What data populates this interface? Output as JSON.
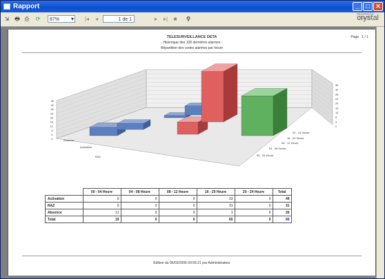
{
  "window": {
    "title": "Rapport"
  },
  "toolbar": {
    "zoom": "87%",
    "page": "1 de 1",
    "brand": "crystal",
    "brand_small": "Business Objects"
  },
  "report": {
    "title": "TELESURVEILLANCE DETA",
    "subtitle1": "- Historique des 100 dernières alarmes -",
    "subtitle2": "Répartition des codes alarmes par heure",
    "page_label": "Page",
    "page_value": "1 / 1",
    "footer": "Édition du   06/03/2006   09:55:21   par   Administrateur"
  },
  "chart_data": {
    "type": "bar",
    "categories": [
      "00 - 04 Heure",
      "04 - 08 Heure",
      "08 - 12 Heure",
      "16 - 20 Heure",
      "20 - 24 Heure"
    ],
    "series": [
      {
        "name": "Activation",
        "values": [
          0,
          0,
          0,
          33,
          0
        ]
      },
      {
        "name": "RAZ",
        "values": [
          0,
          0,
          0,
          31,
          0
        ]
      },
      {
        "name": "Absence",
        "values": [
          11,
          0,
          0,
          1,
          0
        ]
      }
    ],
    "axis_labels": {
      "left": [
        "36",
        "32",
        "28",
        "24",
        "20",
        "16",
        "12",
        "8",
        "4",
        "0"
      ],
      "right": [
        "36",
        "32",
        "28",
        "24",
        "20",
        "16",
        "12",
        "8",
        "4",
        "0"
      ]
    },
    "series_labels": [
      "Absence",
      "Activation",
      "RAZ"
    ],
    "category_labels": [
      "20 - 24 Heure",
      "16 - 20 Heure",
      "08 - 12 Heure",
      "04 - 08 Heure",
      "00 - 04 Heure"
    ],
    "colors": {
      "blue": "#5b7fbf",
      "red": "#e06060",
      "green": "#5fb05f"
    },
    "ylim": [
      0,
      36
    ]
  },
  "table": {
    "headers": [
      "00 - 04 Heure",
      "04 - 08 Heure",
      "08 - 12 Heure",
      "16 - 20 Heure",
      "20 - 24 Heure",
      "Total"
    ],
    "rows": [
      {
        "label": "Activation",
        "values": [
          "0",
          "0",
          "0",
          "33",
          "0",
          "49"
        ]
      },
      {
        "label": "RAZ",
        "values": [
          "0",
          "0",
          "0",
          "31",
          "0",
          "31"
        ]
      },
      {
        "label": "Absence",
        "values": [
          "11",
          "0",
          "0",
          "1",
          "0",
          "26"
        ]
      },
      {
        "label": "Total",
        "values": [
          "19",
          "0",
          "0",
          "65",
          "0",
          "88"
        ]
      }
    ]
  }
}
